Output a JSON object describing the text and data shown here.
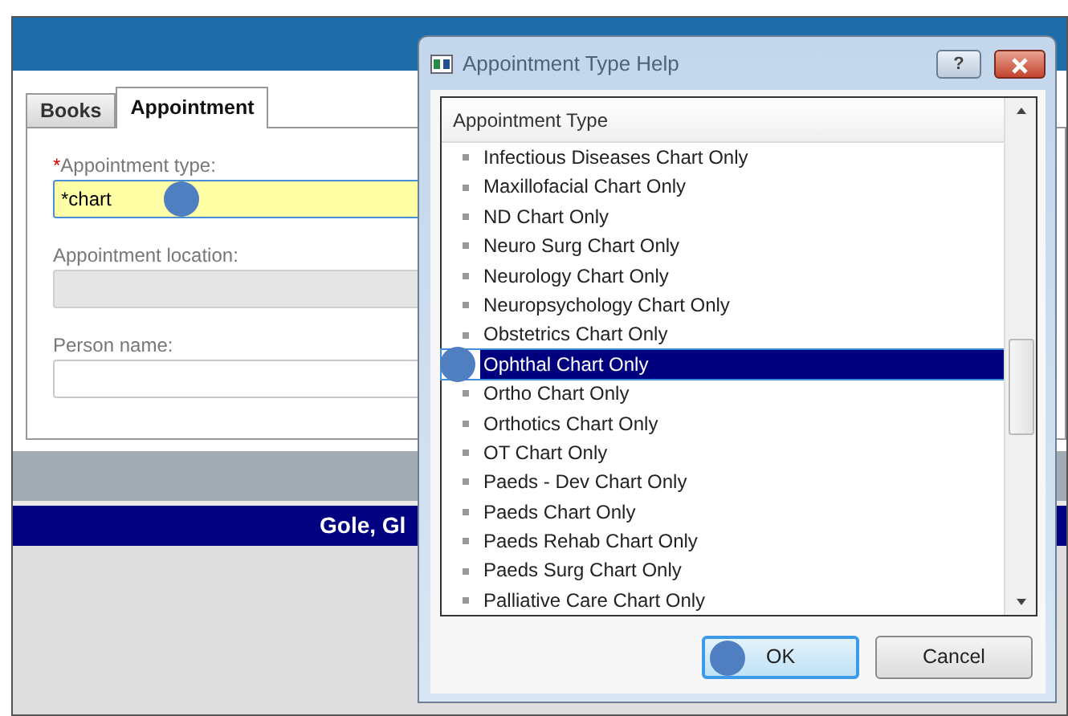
{
  "window": {
    "tabs": [
      {
        "label": "Books",
        "selected": false
      },
      {
        "label": "Appointment",
        "selected": true
      }
    ],
    "fields": [
      {
        "label": "Appointment type:",
        "required_mark": "*",
        "value": "*chart",
        "focused": true,
        "disabled": false
      },
      {
        "label": "Appointment location:",
        "focused": false,
        "disabled": true
      },
      {
        "label": "Person name:",
        "focused": false,
        "disabled": false
      }
    ],
    "patient_banner": "Gole, Gl"
  },
  "dialog": {
    "title": "Appointment Type Help",
    "help_button": "?",
    "list_header": "Appointment Type",
    "items": [
      {
        "label": "Infectious Diseases Chart Only",
        "selected": false
      },
      {
        "label": "Maxillofacial Chart Only",
        "selected": false
      },
      {
        "label": "ND Chart Only",
        "selected": false
      },
      {
        "label": "Neuro Surg Chart Only",
        "selected": false
      },
      {
        "label": "Neurology Chart Only",
        "selected": false
      },
      {
        "label": "Neuropsychology Chart Only",
        "selected": false
      },
      {
        "label": "Obstetrics Chart Only",
        "selected": false
      },
      {
        "label": "Ophthal Chart Only",
        "selected": true
      },
      {
        "label": "Ortho Chart Only",
        "selected": false
      },
      {
        "label": "Orthotics Chart Only",
        "selected": false
      },
      {
        "label": "OT Chart Only",
        "selected": false
      },
      {
        "label": "Paeds - Dev Chart Only",
        "selected": false
      },
      {
        "label": "Paeds Chart Only",
        "selected": false
      },
      {
        "label": "Paeds Rehab Chart Only",
        "selected": false
      },
      {
        "label": "Paeds Surg Chart Only",
        "selected": false
      },
      {
        "label": "Palliative Care Chart Only",
        "selected": false
      }
    ],
    "buttons": [
      {
        "label": "OK",
        "default": true
      },
      {
        "label": "Cancel",
        "default": false
      }
    ]
  }
}
